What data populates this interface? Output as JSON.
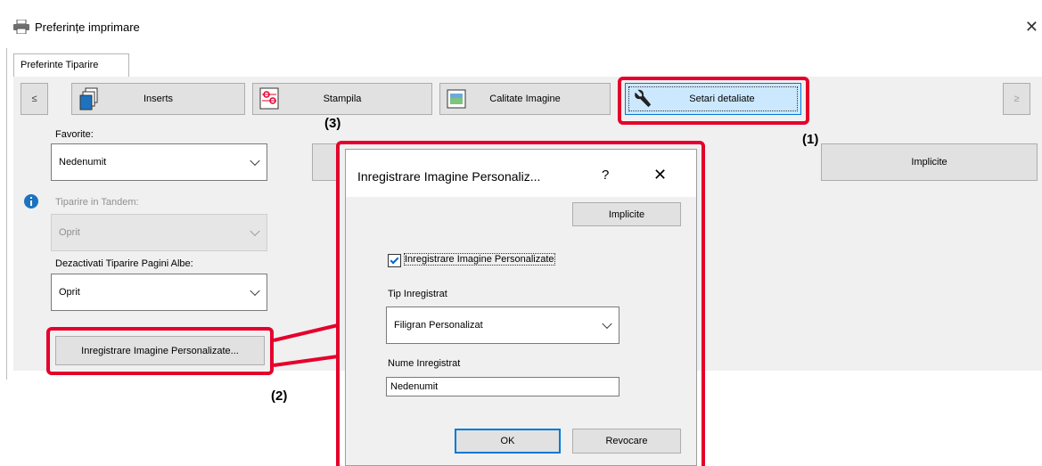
{
  "window": {
    "title": "Preferințe imprimare",
    "close_glyph": "✕"
  },
  "tabs": [
    {
      "label": "Preferinte Tiparire"
    }
  ],
  "nav": {
    "prev_label": "≤",
    "next_label": "≥"
  },
  "features": [
    {
      "label": "Inserts",
      "icon": "inserts-icon"
    },
    {
      "label": "Stampila",
      "icon": "stamp-icon"
    },
    {
      "label": "Calitate Imagine",
      "icon": "image-quality-icon"
    },
    {
      "label": "Setari detaliate",
      "icon": "wrench-icon"
    }
  ],
  "favorites": {
    "label": "Favorite:",
    "value": "Nedenumit",
    "defaults_button": "Implicite"
  },
  "tandem": {
    "label": "Tiparire in Tandem:",
    "value": "Oprit"
  },
  "blank_pages": {
    "label": "Dezactivati Tiparire Pagini Albe:",
    "value": "Oprit"
  },
  "register_image_button": "Inregistrare Imagine Personalizate...",
  "callouts": {
    "one": "(1)",
    "two": "(2)",
    "three": "(3)"
  },
  "dialog": {
    "title": "Inregistrare Imagine Personaliz...",
    "help_glyph": "?",
    "close_glyph": "✕",
    "defaults_button": "Implicite",
    "checkbox_label": "Inregistrare Imagine Personalizate",
    "checkbox_checked": true,
    "type_label": "Tip Inregistrat",
    "type_value": "Filigran Personalizat",
    "name_label": "Nume Inregistrat",
    "name_value": "Nedenumit",
    "ok_button": "OK",
    "cancel_button": "Revocare"
  },
  "colors": {
    "highlight_red": "#e5002c",
    "selected_blue": "#cce8ff",
    "info_blue": "#1e73be"
  }
}
